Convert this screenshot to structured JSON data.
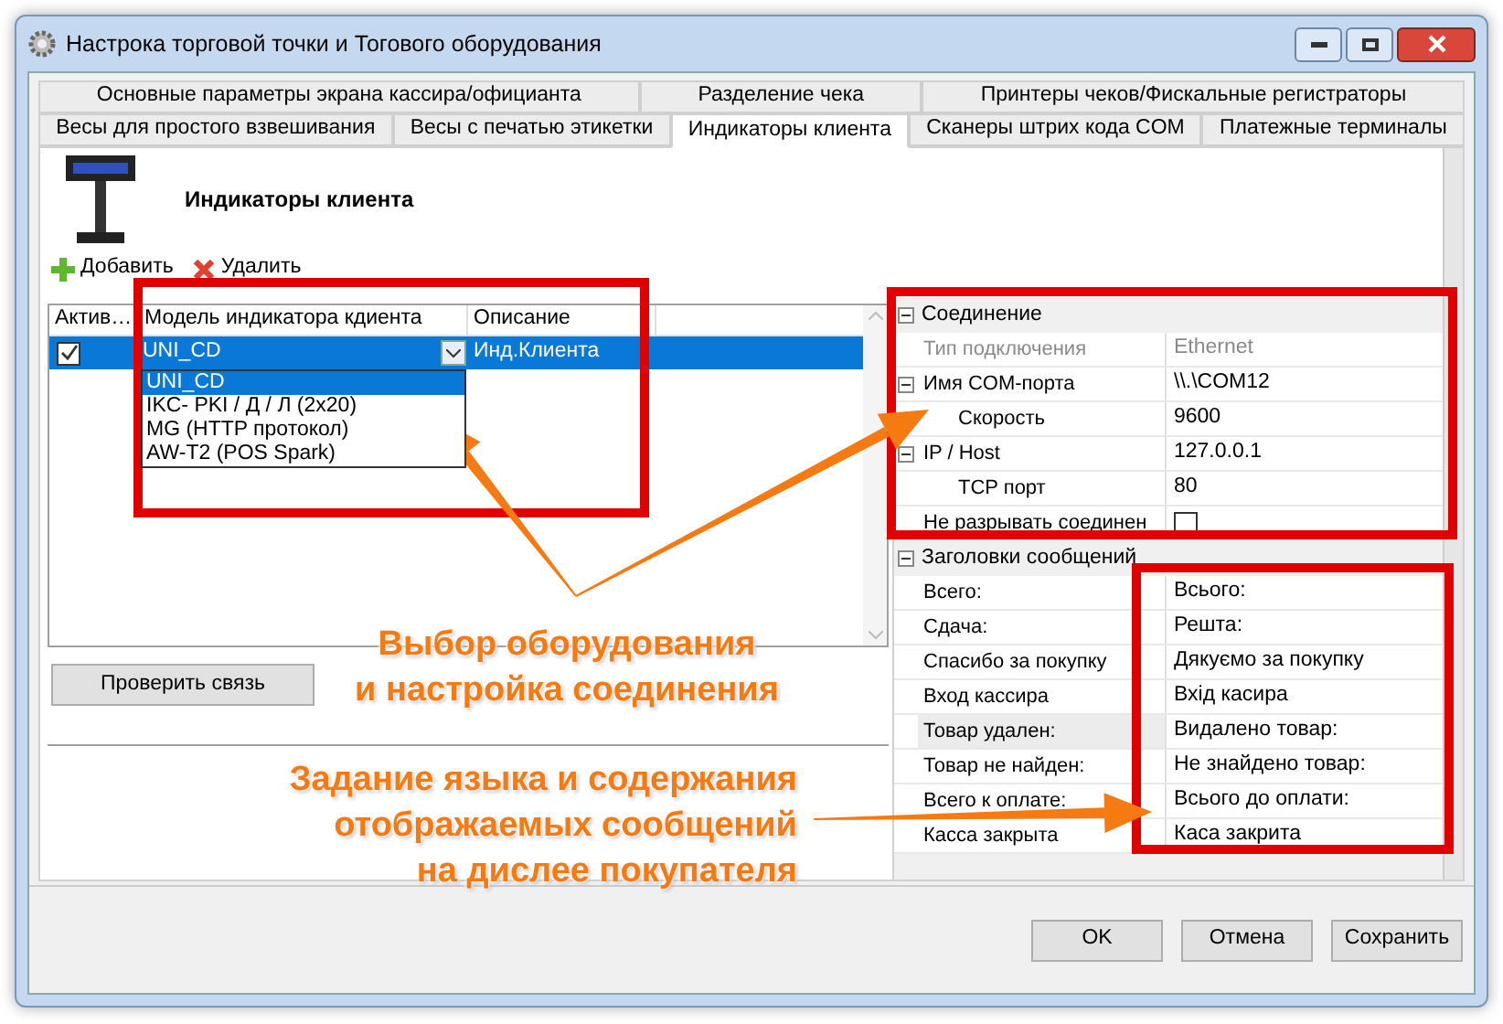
{
  "window": {
    "title": "Настрока торговой точки и Тогового оборудования"
  },
  "tab_rows": [
    [
      {
        "label": "Основные параметры экрана кассира/официанта",
        "selected": false
      },
      {
        "label": "Разделение чека",
        "selected": false
      },
      {
        "label": "Принтеры чеков/Фискальные регистраторы",
        "selected": false
      }
    ],
    [
      {
        "label": "Весы для простого взвешивания",
        "selected": false
      },
      {
        "label": "Весы с печатью этикетки",
        "selected": false
      },
      {
        "label": "Индикаторы клиента",
        "selected": true
      },
      {
        "label": "Сканеры штрих кода COM",
        "selected": false
      },
      {
        "label": "Платежные терминалы",
        "selected": false
      }
    ]
  ],
  "header": {
    "title": "Индикаторы клиента"
  },
  "toolbar": [
    {
      "kind": "add",
      "label": "Добавить"
    },
    {
      "kind": "delete",
      "label": "Удалить"
    }
  ],
  "table": {
    "columns": [
      "Актив…",
      "Модель индикатора кдиента",
      "Описание"
    ],
    "rows": [
      {
        "active": true,
        "selected": true,
        "model": "UNI_CD",
        "description": "Инд.Клиента"
      }
    ]
  },
  "dropdown": {
    "options": [
      {
        "label": "UNI_CD",
        "selected": true
      },
      {
        "label": "IKC- PKI / Д / Л (2x20)",
        "selected": false
      },
      {
        "label": "MG (HTTP протокол)",
        "selected": false
      },
      {
        "label": "AW-T2 (POS Spark)",
        "selected": false
      }
    ]
  },
  "check_button": "Проверить связь",
  "property_groups": [
    {
      "title": "Соединение",
      "expanded": true,
      "rows": [
        {
          "kind": "text",
          "label": "Тип подключения",
          "value": "Ethernet",
          "disabled": true
        },
        {
          "kind": "text",
          "label": "Имя COM-порта",
          "value": "\\\\.\\COM12",
          "disabled": false,
          "expanded": true,
          "children": [
            {
              "kind": "text",
              "label": "Скорость",
              "value": "9600",
              "disabled": false
            }
          ]
        },
        {
          "kind": "text",
          "label": "IP / Host",
          "value": "127.0.0.1",
          "disabled": false,
          "expanded": true,
          "children": [
            {
              "kind": "text",
              "label": "TCP порт",
              "value": "80",
              "disabled": false
            }
          ]
        },
        {
          "kind": "checkbox",
          "label": "Не разрывать соединен",
          "checked": false,
          "disabled": false
        }
      ]
    },
    {
      "title": "Заголовки сообщений",
      "expanded": true,
      "rows": [
        {
          "kind": "text",
          "label": "Всего:",
          "value": "Всього:",
          "disabled": false
        },
        {
          "kind": "text",
          "label": "Сдача:",
          "value": "Решта:",
          "disabled": false
        },
        {
          "kind": "text",
          "label": "Спасибо за покупку",
          "value": "Дякуємо за покупку",
          "disabled": false
        },
        {
          "kind": "text",
          "label": "Вход кассира",
          "value": "Вхід касира",
          "disabled": false
        },
        {
          "kind": "text",
          "label": "Товар удален:",
          "value": "Видалено товар:",
          "disabled": false,
          "selected": true
        },
        {
          "kind": "text",
          "label": "Товар не найден:",
          "value": "Не знайдено товар:",
          "disabled": false
        },
        {
          "kind": "text",
          "label": "Всего к оплате:",
          "value": "Всього до оплати:",
          "disabled": false
        },
        {
          "kind": "text",
          "label": "Касса закрыта",
          "value": "Каса закрита",
          "disabled": false
        }
      ]
    }
  ],
  "buttons": [
    "OK",
    "Отмена",
    "Сохранить"
  ],
  "annotations": [
    {
      "lines": [
        "Выбор оборудования",
        "и настройка соединения"
      ]
    },
    {
      "lines": [
        "Задание языка и содержания",
        "отображаемых сообщений",
        "на дислее покупателя"
      ]
    }
  ]
}
